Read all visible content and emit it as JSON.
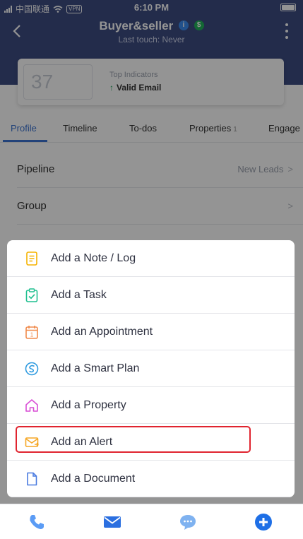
{
  "status_bar": {
    "carrier": "中国联通",
    "vpn": "VPN",
    "time": "6:10 PM"
  },
  "header": {
    "title": "Buyer&seller",
    "subtitle": "Last touch: Never",
    "badge_info_icon": "info-badge-icon",
    "badge_dollar": "$",
    "colors": {
      "background": "#3d4c82",
      "info_badge": "#3b8cf0",
      "dollar_badge": "#22b45a"
    }
  },
  "summary_card": {
    "score": "37",
    "indicators_label": "Top Indicators",
    "indicator_value": "Valid Email"
  },
  "tabs": [
    {
      "label": "Profile",
      "active": true
    },
    {
      "label": "Timeline"
    },
    {
      "label": "To-dos"
    },
    {
      "label": "Properties",
      "count": "1"
    },
    {
      "label": "Engage"
    }
  ],
  "profile_rows": [
    {
      "label": "Pipeline",
      "value": "New Leads",
      "chevron": ">"
    },
    {
      "label": "Group",
      "value": "",
      "chevron": ">"
    }
  ],
  "action_sheet": {
    "items": [
      {
        "label": "Add a Note / Log",
        "icon": "note-icon",
        "color": "#f5b300"
      },
      {
        "label": "Add a Task",
        "icon": "task-clipboard-icon",
        "color": "#1fbf8f"
      },
      {
        "label": "Add an Appointment",
        "icon": "calendar-icon",
        "color": "#f08a4b"
      },
      {
        "label": "Add a Smart Plan",
        "icon": "smart-plan-icon",
        "color": "#2f9be0"
      },
      {
        "label": "Add a Property",
        "icon": "house-icon",
        "color": "#d94fd6"
      },
      {
        "label": "Add an Alert",
        "icon": "alert-envelope-icon",
        "color": "#f5a623",
        "highlighted": true
      },
      {
        "label": "Add a Document",
        "icon": "document-icon",
        "color": "#4a7be0"
      }
    ],
    "highlight_color": "#e0242f"
  },
  "bottom_bar": {
    "items": [
      "phone-icon",
      "mail-icon",
      "chat-icon",
      "add-circle-icon"
    ],
    "colors": {
      "phone": "#5b9cf5",
      "mail": "#2b6fe0",
      "chat": "#7fb2f0",
      "add": "#1e6fe6"
    }
  }
}
